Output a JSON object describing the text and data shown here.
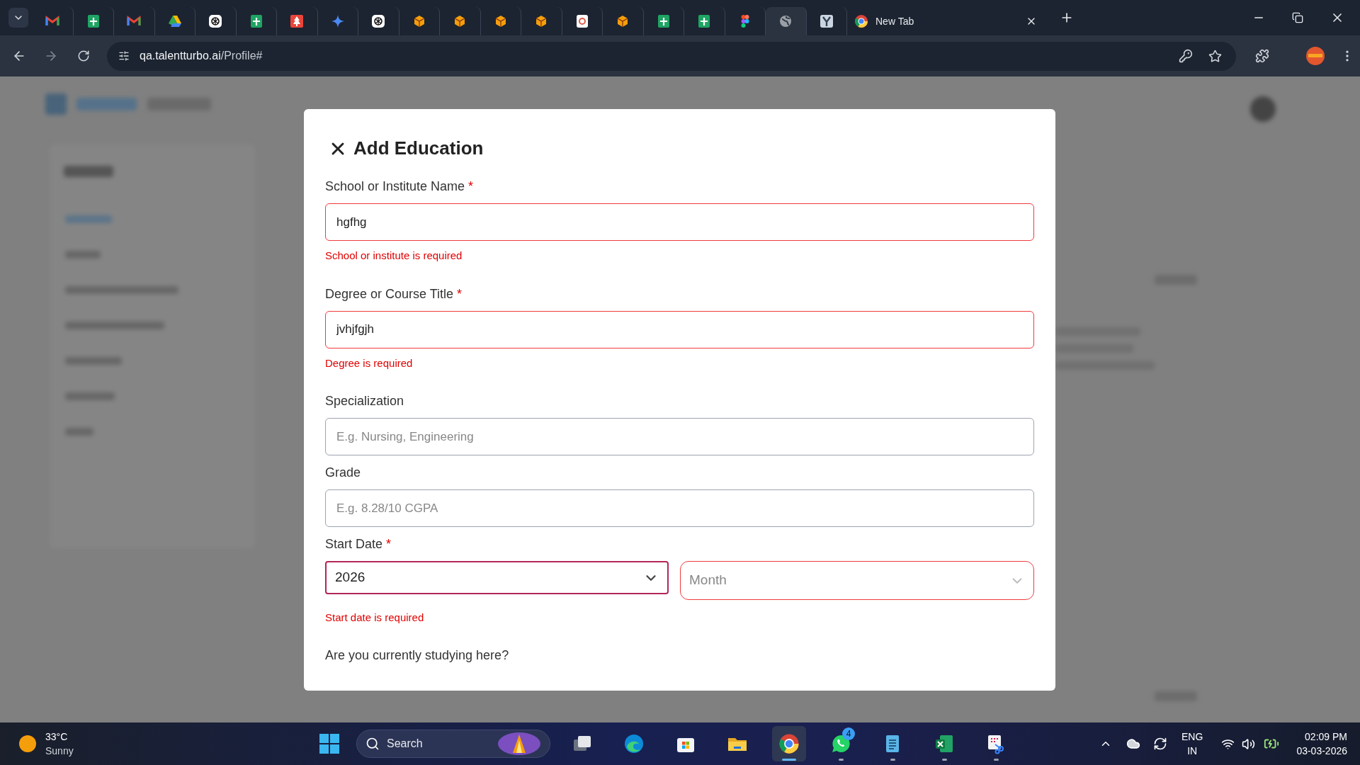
{
  "browser": {
    "tabs": [
      {
        "kind": "mail",
        "selected": false
      },
      {
        "kind": "sheet",
        "selected": false
      },
      {
        "kind": "mail",
        "selected": false
      },
      {
        "kind": "drive",
        "selected": false
      },
      {
        "kind": "spiral",
        "selected": false
      },
      {
        "kind": "sheet",
        "selected": false
      },
      {
        "kind": "tree",
        "selected": false
      },
      {
        "kind": "sparkle",
        "selected": false
      },
      {
        "kind": "spiral",
        "selected": false
      },
      {
        "kind": "cube",
        "selected": false
      },
      {
        "kind": "cube",
        "selected": false
      },
      {
        "kind": "cube",
        "selected": false
      },
      {
        "kind": "cube",
        "selected": false
      },
      {
        "kind": "doc",
        "selected": false
      },
      {
        "kind": "cube",
        "selected": false
      },
      {
        "kind": "sheet",
        "selected": false
      },
      {
        "kind": "sheet",
        "selected": false
      },
      {
        "kind": "figma",
        "selected": false
      },
      {
        "kind": "globe",
        "selected": true
      },
      {
        "kind": "fork",
        "selected": false
      },
      {
        "kind": "chrome",
        "title": "New Tab",
        "selected": false
      }
    ],
    "url_host": "qa.talentturbo.ai",
    "url_path": "/Profile#"
  },
  "dialog": {
    "title": "Add Education",
    "fields": [
      {
        "kind": "text",
        "label": "School or Institute Name",
        "required_mark": "*",
        "value": "hgfhg",
        "invalid": true,
        "error": "School or institute is required"
      },
      {
        "kind": "text",
        "label": "Degree or Course Title",
        "required_mark": "*",
        "value": "jvhjfgjh",
        "invalid": true,
        "error": "Degree is required"
      },
      {
        "kind": "text",
        "label": "Specialization",
        "placeholder": "E.g. Nursing, Engineering",
        "invalid": false
      },
      {
        "kind": "text",
        "label": "Grade",
        "placeholder": "E.g. 8.28/10 CGPA",
        "invalid": false
      },
      {
        "kind": "date",
        "label": "Start Date",
        "required_mark": "*",
        "selects": [
          {
            "value": "2026",
            "focused": true,
            "invalid": true
          },
          {
            "placeholder": "Month",
            "focused": false,
            "invalid": true
          }
        ],
        "error": "Start date is required"
      },
      {
        "kind": "question",
        "label": "Are you currently studying here?"
      }
    ]
  },
  "taskbar": {
    "weather": {
      "temperature": "33°C",
      "condition": "Sunny"
    },
    "search": {
      "placeholder": "Search"
    },
    "apps": [
      {
        "kind": "taskview",
        "running": false,
        "selected": false
      },
      {
        "kind": "edge",
        "running": false,
        "selected": false
      },
      {
        "kind": "store",
        "running": false,
        "selected": false
      },
      {
        "kind": "folder",
        "running": false,
        "selected": false
      },
      {
        "kind": "chrome",
        "running": true,
        "selected": true
      },
      {
        "kind": "whatsapp",
        "running": true,
        "selected": false,
        "badge": "4"
      },
      {
        "kind": "notepad",
        "running": true,
        "selected": false
      },
      {
        "kind": "excel",
        "running": true,
        "selected": false
      },
      {
        "kind": "snip",
        "running": true,
        "selected": false
      }
    ],
    "tray": {
      "language": "ENG",
      "region": "IN",
      "time": "02:09 PM",
      "date": "03-03-2026"
    }
  }
}
